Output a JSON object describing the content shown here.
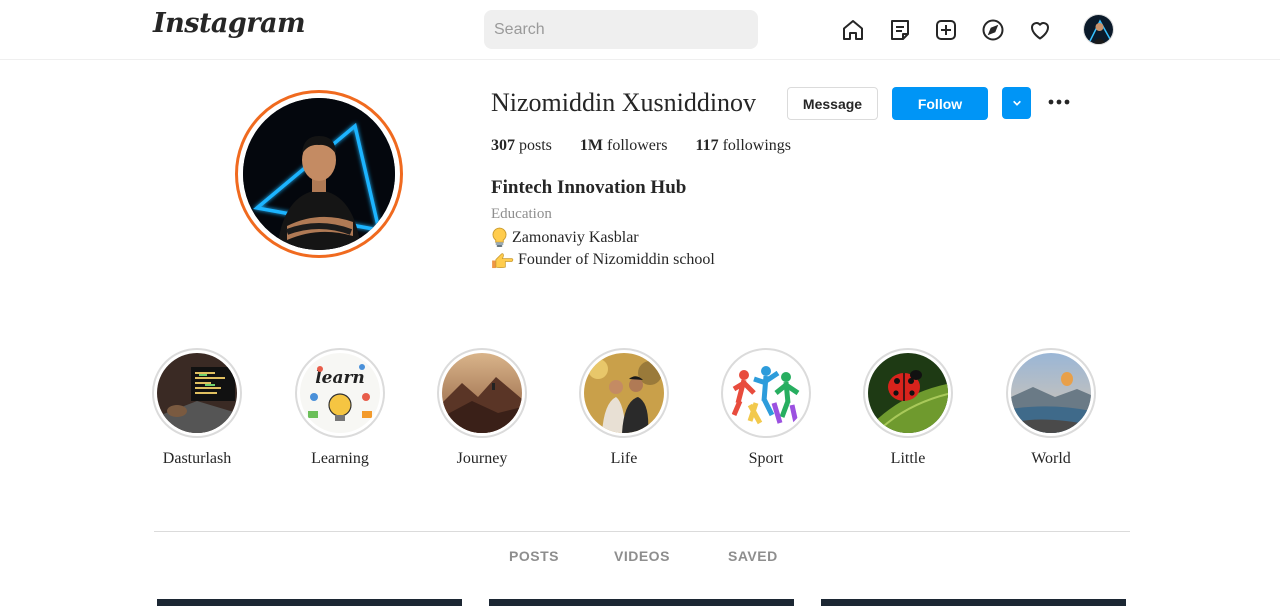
{
  "nav": {
    "logo": "Instagram",
    "search_placeholder": "Search",
    "icons": [
      "home-icon",
      "messages-icon",
      "create-post-icon",
      "explore-icon",
      "notifications-icon",
      "profile-avatar"
    ]
  },
  "profile": {
    "username": "Nizomiddin Xusniddinov",
    "message_label": "Message",
    "follow_label": "Follow",
    "stats": [
      {
        "value": "307",
        "label": "posts"
      },
      {
        "value": "1M",
        "label": "followers"
      },
      {
        "value": "117",
        "label": "followings"
      }
    ],
    "full_name": "Fintech Innovation Hub",
    "category": "Education",
    "bio": [
      {
        "icon": "lightbulb-icon",
        "text": "Zamonaviy Kasblar"
      },
      {
        "icon": "pointing-hand-icon",
        "text": "Founder of Nizomiddin school"
      }
    ]
  },
  "highlights": [
    {
      "label": "Dasturlash"
    },
    {
      "label": "Learning"
    },
    {
      "label": "Journey"
    },
    {
      "label": "Life"
    },
    {
      "label": "Sport"
    },
    {
      "label": "Little"
    },
    {
      "label": "World"
    }
  ],
  "tabs": [
    {
      "label": "POSTS"
    },
    {
      "label": "VIDEOS"
    },
    {
      "label": "SAVED"
    }
  ],
  "colors": {
    "accent": "#0095f6",
    "story_ring": "#f06a1f",
    "muted": "#8e8e8e"
  }
}
